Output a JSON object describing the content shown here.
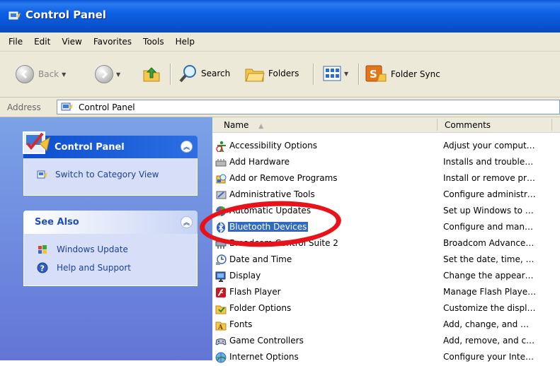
{
  "window": {
    "title": "Control Panel"
  },
  "menu": [
    "File",
    "Edit",
    "View",
    "Favorites",
    "Tools",
    "Help"
  ],
  "toolbar": {
    "back": "Back",
    "search": "Search",
    "folders": "Folders",
    "folder_sync": "Folder Sync"
  },
  "address": {
    "label": "Address",
    "value": "Control Panel"
  },
  "taskpane": {
    "control_panel": {
      "title": "Control Panel",
      "switch_link": "Switch to Category View"
    },
    "see_also": {
      "title": "See Also",
      "links": [
        "Windows Update",
        "Help and Support"
      ]
    }
  },
  "list": {
    "columns": {
      "name": "Name",
      "comments": "Comments"
    },
    "items": [
      {
        "name": "Accessibility Options",
        "comment": "Adjust your comput…",
        "icon": "accessibility-icon"
      },
      {
        "name": "Add Hardware",
        "comment": "Installs and trouble…",
        "icon": "add-hardware-icon"
      },
      {
        "name": "Add or Remove Programs",
        "comment": "Install or remove pr…",
        "icon": "add-remove-programs-icon"
      },
      {
        "name": "Administrative Tools",
        "comment": "Configure administr…",
        "icon": "administrative-tools-icon"
      },
      {
        "name": "Automatic Updates",
        "comment": "Set up Windows to …",
        "icon": "automatic-updates-icon"
      },
      {
        "name": "Bluetooth Devices",
        "comment": "Configure and man…",
        "icon": "bluetooth-icon",
        "selected": true
      },
      {
        "name": "Broadcom Control Suite 2",
        "comment": "Broadcom Advance…",
        "icon": "broadcom-icon"
      },
      {
        "name": "Date and Time",
        "comment": "Set the date, time, …",
        "icon": "clock-icon"
      },
      {
        "name": "Display",
        "comment": "Change the appear…",
        "icon": "display-icon"
      },
      {
        "name": "Flash Player",
        "comment": "Manage Flash Playe…",
        "icon": "flash-player-icon"
      },
      {
        "name": "Folder Options",
        "comment": "Customize the displ…",
        "icon": "folder-options-icon"
      },
      {
        "name": "Fonts",
        "comment": "Add, change, and …",
        "icon": "fonts-folder-icon"
      },
      {
        "name": "Game Controllers",
        "comment": "Add, remove, and c…",
        "icon": "game-controller-icon"
      },
      {
        "name": "Internet Options",
        "comment": "Configure your Inte…",
        "icon": "internet-options-icon"
      }
    ]
  },
  "colors": {
    "titlebar": "#0c5fe3",
    "taskpane": "#6f8fe0",
    "selection": "#316ac5",
    "highlight_ring": "#e8121a"
  }
}
